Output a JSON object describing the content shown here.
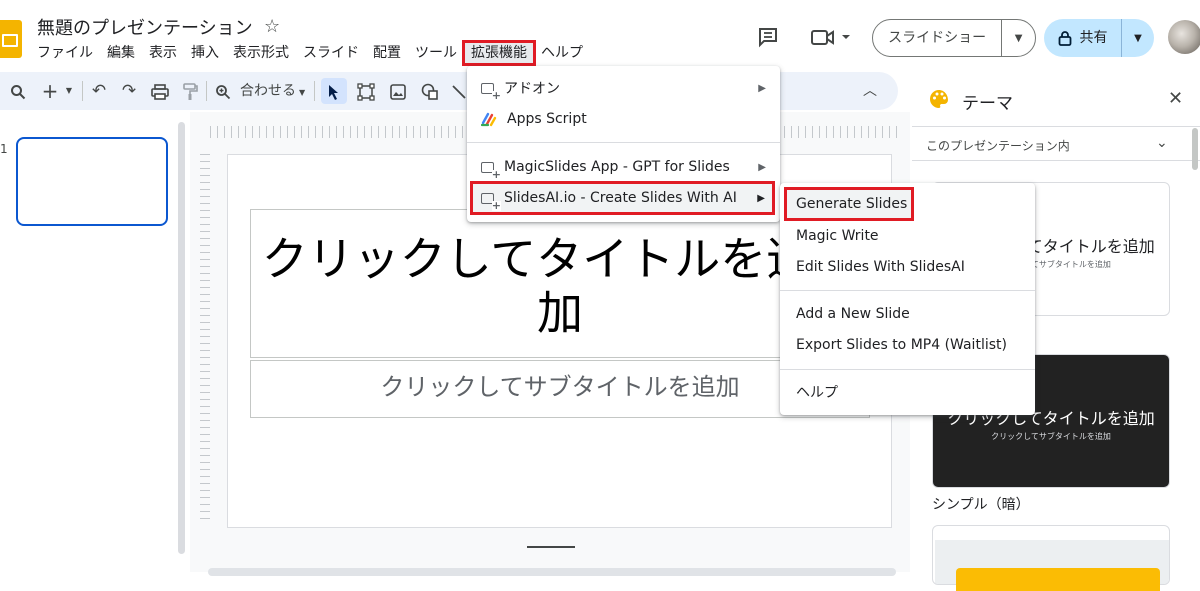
{
  "header": {
    "doc_title": "無題のプレゼンテーション",
    "menus": [
      "ファイル",
      "編集",
      "表示",
      "挿入",
      "表示形式",
      "スライド",
      "配置",
      "ツール",
      "拡張機能",
      "ヘルプ"
    ],
    "active_menu_index": 8,
    "slideshow_label": "スライドショー",
    "share_label": "共有",
    "icons": {
      "logo": "slides-logo-icon",
      "star": "star-icon",
      "comment": "comment-icon",
      "meet": "meet-icon",
      "lock": "lock-icon"
    }
  },
  "toolbar": {
    "zoom_label": "合わせる"
  },
  "filmstrip": {
    "slide_number": "1"
  },
  "slide": {
    "title_placeholder": "クリックしてタイトルを追加",
    "title_placeholder_overflow": "加",
    "subtitle_placeholder": "クリックしてサブタイトルを追加"
  },
  "theme_panel": {
    "title": "テーマ",
    "filter": "このプレゼンテーション内",
    "theme1_title": "クリックしてタイトルを追加",
    "theme1_subtitle": "クリックしてサブタイトルを追加",
    "theme2_title": "クリックしてタイトルを追加",
    "theme2_subtitle": "クリックしてサブタイトルを追加",
    "theme2_name": "シンプル（暗）"
  },
  "extensions_menu": {
    "items": [
      {
        "label": "アドオン",
        "has_submenu": true,
        "icon": "addon-icon"
      },
      {
        "label": "Apps Script",
        "has_submenu": false,
        "icon": "apps-script-icon"
      },
      {
        "label": "MagicSlides App - GPT for Slides",
        "has_submenu": true,
        "icon": "addon-icon"
      },
      {
        "label": "SlidesAI.io - Create Slides With AI",
        "has_submenu": true,
        "icon": "addon-icon"
      }
    ]
  },
  "slidesai_submenu": {
    "items": [
      {
        "label": "Generate Slides"
      },
      {
        "label": "Magic Write"
      },
      {
        "label": "Edit Slides With SlidesAI"
      },
      {
        "label": "Add a New Slide"
      },
      {
        "label": "Export Slides to MP4 (Waitlist)"
      },
      {
        "label": "ヘルプ"
      }
    ]
  },
  "colors": {
    "accent": "#0b57d0",
    "highlight_box": "#e01b24",
    "toolbar_bg": "#edf2fa",
    "share_bg": "#c2e7ff",
    "slides_yellow": "#f4b400"
  }
}
